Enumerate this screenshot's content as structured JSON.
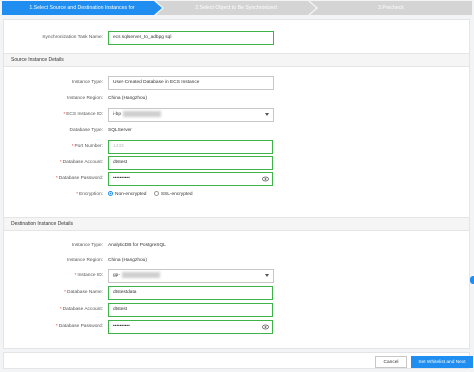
{
  "steps": [
    {
      "label": "1.Select Source and Destination Instances for"
    },
    {
      "label": "2.Select Object to Be Synchronized"
    },
    {
      "label": "3.Precheck"
    }
  ],
  "task": {
    "label": "Synchronization Task Name:",
    "value": "ecs sqlserver_to_adbpg sql"
  },
  "source": {
    "header": "Source Instance Details",
    "instance_type": {
      "label": "Instance Type:",
      "value": "User-Created Database in ECS Instance"
    },
    "region": {
      "label": "Instance Region:",
      "value": "China (Hangzhou)"
    },
    "ecs_id": {
      "label": "ECS Instance ID:",
      "value": "i-bp"
    },
    "db_type": {
      "label": "Database Type:",
      "value": "SQLServer"
    },
    "port": {
      "label": "Port Number:",
      "value": "1433"
    },
    "account": {
      "label": "Database Account:",
      "value": "dtstest"
    },
    "password": {
      "label": "Database Password:",
      "value": "••••••••••"
    },
    "encryption": {
      "label": "Encryption:",
      "options": [
        "Non-encrypted",
        "SSL-encrypted"
      ],
      "selected": "Non-encrypted"
    }
  },
  "destination": {
    "header": "Destination Instance Details",
    "instance_type": {
      "label": "Instance Type:",
      "value": "AnalyticDB for PostgreSQL"
    },
    "region": {
      "label": "Instance Region:",
      "value": "China (Hangzhou)"
    },
    "instance_id": {
      "label": "Instance ID:",
      "value": "gp-"
    },
    "db_name": {
      "label": "Database Name:",
      "value": "dtstestdata"
    },
    "account": {
      "label": "Database Account:",
      "value": "dtstest"
    },
    "password": {
      "label": "Database Password:",
      "value": "••••••••••"
    }
  },
  "footer": {
    "cancel": "Cancel",
    "next": "Set Whitelist and Next"
  },
  "colors": {
    "accent": "#1f8ef0",
    "input_border": "#3fb24a",
    "required": "#e33333"
  },
  "icons": {
    "password_toggle": "eye-icon",
    "dropdown": "chevron-down-icon"
  }
}
